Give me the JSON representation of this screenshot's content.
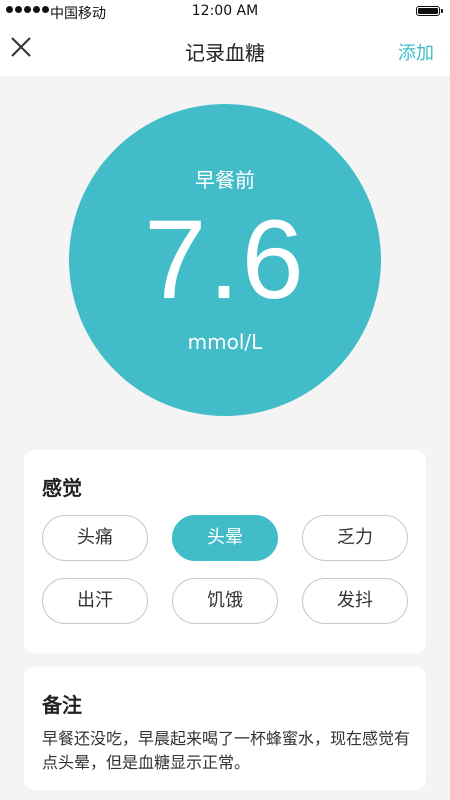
{
  "status_bar": {
    "carrier": "中国移动",
    "time": "12:00 AM"
  },
  "nav": {
    "title": "记录血糖",
    "add_label": "添加",
    "close_icon": "close-icon"
  },
  "reading": {
    "meal": "早餐前",
    "value": "7.6",
    "unit": "mmol/L",
    "color": "#42bcc9"
  },
  "feeling": {
    "title": "感觉",
    "options": [
      {
        "label": "头痛",
        "selected": false
      },
      {
        "label": "头晕",
        "selected": true
      },
      {
        "label": "乏力",
        "selected": false
      },
      {
        "label": "出汗",
        "selected": false
      },
      {
        "label": "饥饿",
        "selected": false
      },
      {
        "label": "发抖",
        "selected": false
      }
    ]
  },
  "note": {
    "title": "备注",
    "text": "早餐还没吃，早晨起来喝了一杯蜂蜜水，现在感觉有点头晕，但是血糖显示正常。"
  }
}
